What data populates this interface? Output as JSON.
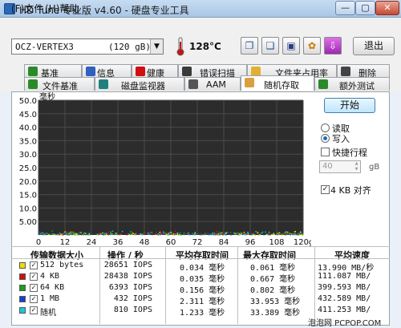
{
  "window": {
    "title": "HD Tune 专业版 v4.60 - 硬盘专业工具",
    "min_glyph": "—",
    "max_glyph": "▢",
    "close_glyph": "✕"
  },
  "menu": {
    "file": "(F)文件",
    "help": "(H)帮助"
  },
  "toolbar": {
    "drive_name": "OCZ-VERTEX3",
    "drive_size": "(120 gB)",
    "temperature": "128°C",
    "exit_label": "退出",
    "copy_text_glyph": "❐",
    "copy_screen_glyph": "❏",
    "save_glyph": "▣",
    "options_glyph": "✿",
    "download_glyph": "⇩"
  },
  "tabs": {
    "row1": [
      "基准",
      "信息",
      "健康",
      "错误扫描",
      "文件夹占用率",
      "删除"
    ],
    "row2": [
      "文件基准",
      "磁盘监视器",
      "AAM",
      "随机存取",
      "额外测试"
    ],
    "active": "随机存取"
  },
  "graph": {
    "unit_label": "毫秒",
    "y_ticks": [
      "50.0",
      "45.0",
      "40.0",
      "35.0",
      "30.0",
      "25.0",
      "20.0",
      "15.0",
      "10.0",
      "5.00"
    ],
    "x_ticks": [
      "0",
      "12",
      "24",
      "36",
      "48",
      "60",
      "72",
      "84",
      "96",
      "108",
      "120gB"
    ],
    "y_max_ms": 50,
    "x_max_gb": 120,
    "band_max_ms": 1.5
  },
  "controls": {
    "start_label": "开始",
    "read_label": "读取",
    "write_label": "写入",
    "mode": "write",
    "short_stroke_label": "快捷行程",
    "short_stroke_enabled": false,
    "stroke_value": "40",
    "stroke_unit": "gB",
    "align_label": "4 KB 对齐",
    "align_enabled": true
  },
  "results": {
    "headers": [
      "传输数据大小",
      "操作 / 秒",
      "平均存取时间",
      "最大存取时间",
      "平均速度"
    ],
    "rows": [
      {
        "color": "#e8e000",
        "size": "512 bytes",
        "iops": "28651 IOPS",
        "avg": "0.034 毫秒",
        "max": "0.061 毫秒",
        "speed": "13.990 MB/秒"
      },
      {
        "color": "#d01010",
        "size": "4 KB",
        "iops": "28438 IOPS",
        "avg": "0.035 毫秒",
        "max": "0.667 毫秒",
        "speed": "111.087 MB/"
      },
      {
        "color": "#18a018",
        "size": "64 KB",
        "iops": "6393 IOPS",
        "avg": "0.156 毫秒",
        "max": "0.802 毫秒",
        "speed": "399.593 MB/"
      },
      {
        "color": "#1840d0",
        "size": "1 MB",
        "iops": "432 IOPS",
        "avg": "2.311 毫秒",
        "max": "33.953 毫秒",
        "speed": "432.589 MB/"
      },
      {
        "color": "#18c8d8",
        "size": "随机",
        "iops": "810 IOPS",
        "avg": "1.233 毫秒",
        "max": "33.389 毫秒",
        "speed": "411.253 MB/"
      }
    ]
  },
  "watermark": "泡泡网 PCPOP.COM"
}
